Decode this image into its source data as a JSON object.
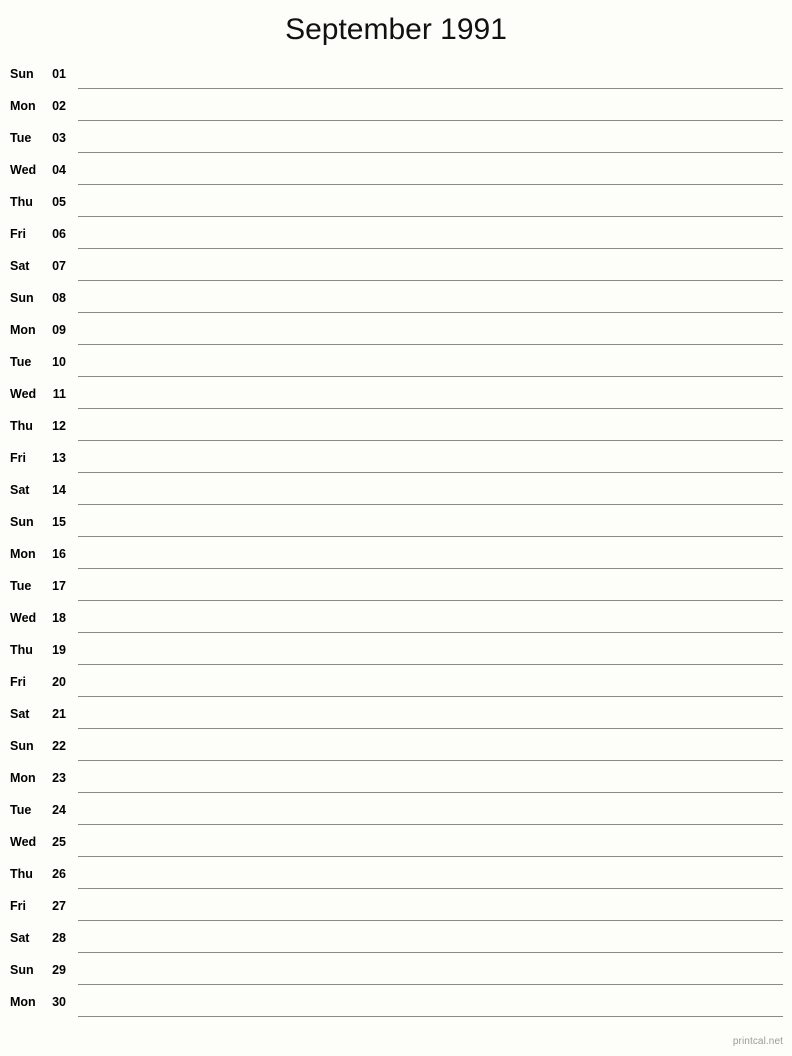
{
  "header": {
    "title": "September 1991",
    "month": "September",
    "year": "1991"
  },
  "calendar": {
    "type": "single-column-notepad-month",
    "day_count": 30,
    "days": [
      {
        "weekday": "Sun",
        "number": "01"
      },
      {
        "weekday": "Mon",
        "number": "02"
      },
      {
        "weekday": "Tue",
        "number": "03"
      },
      {
        "weekday": "Wed",
        "number": "04"
      },
      {
        "weekday": "Thu",
        "number": "05"
      },
      {
        "weekday": "Fri",
        "number": "06"
      },
      {
        "weekday": "Sat",
        "number": "07"
      },
      {
        "weekday": "Sun",
        "number": "08"
      },
      {
        "weekday": "Mon",
        "number": "09"
      },
      {
        "weekday": "Tue",
        "number": "10"
      },
      {
        "weekday": "Wed",
        "number": "11"
      },
      {
        "weekday": "Thu",
        "number": "12"
      },
      {
        "weekday": "Fri",
        "number": "13"
      },
      {
        "weekday": "Sat",
        "number": "14"
      },
      {
        "weekday": "Sun",
        "number": "15"
      },
      {
        "weekday": "Mon",
        "number": "16"
      },
      {
        "weekday": "Tue",
        "number": "17"
      },
      {
        "weekday": "Wed",
        "number": "18"
      },
      {
        "weekday": "Thu",
        "number": "19"
      },
      {
        "weekday": "Fri",
        "number": "20"
      },
      {
        "weekday": "Sat",
        "number": "21"
      },
      {
        "weekday": "Sun",
        "number": "22"
      },
      {
        "weekday": "Mon",
        "number": "23"
      },
      {
        "weekday": "Tue",
        "number": "24"
      },
      {
        "weekday": "Wed",
        "number": "25"
      },
      {
        "weekday": "Thu",
        "number": "26"
      },
      {
        "weekday": "Fri",
        "number": "27"
      },
      {
        "weekday": "Sat",
        "number": "28"
      },
      {
        "weekday": "Sun",
        "number": "29"
      },
      {
        "weekday": "Mon",
        "number": "30"
      }
    ]
  },
  "footer": {
    "attribution": "printcal.net"
  },
  "colors": {
    "background": "#fdfdfa",
    "text": "#000000",
    "title": "#111111",
    "rule": "#8b8b86",
    "footer": "#9a9a96"
  }
}
